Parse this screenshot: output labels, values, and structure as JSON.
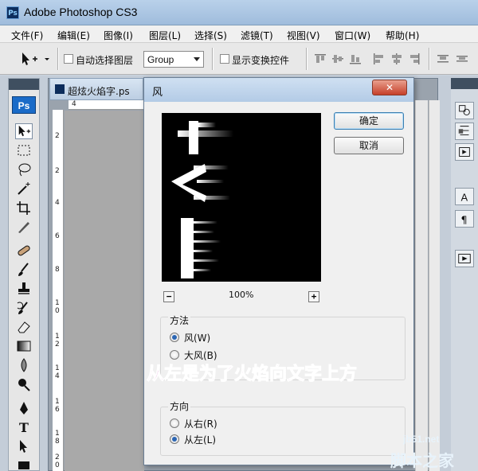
{
  "window": {
    "title": "Adobe Photoshop CS3",
    "icon": "photoshop-app-icon"
  },
  "menubar": {
    "items": [
      "文件(F)",
      "编辑(E)",
      "图像(I)",
      "图层(L)",
      "选择(S)",
      "滤镜(T)",
      "视图(V)",
      "窗口(W)",
      "帮助(H)"
    ]
  },
  "options_bar": {
    "auto_select_label": "自动选择图层",
    "auto_select_checked": false,
    "group_value": "Group",
    "show_transform_label": "显示变换控件",
    "show_transform_checked": false
  },
  "toolbox": {
    "badge": "Ps"
  },
  "document": {
    "tab_title": "超炫火焰字.ps",
    "ruler_top": [
      "4"
    ],
    "ruler_left": [
      "2",
      "2",
      "4",
      "6",
      "8",
      "1",
      "0",
      "1",
      "2",
      "1",
      "4",
      "1",
      "6",
      "1",
      "8",
      "2",
      "0",
      "2",
      "2"
    ]
  },
  "dialog": {
    "title": "风",
    "close_label": "✕",
    "ok_label": "确定",
    "cancel_label": "取消",
    "zoom_minus": "−",
    "zoom_plus": "+",
    "zoom_level": "100%",
    "method": {
      "title": "方法",
      "options": [
        "风(W)",
        "大风(B)"
      ],
      "selected": 0
    },
    "direction": {
      "title": "方向",
      "options": [
        "从右(R)",
        "从左(L)"
      ],
      "selected": 1
    }
  },
  "annotation": {
    "caption": "从左是为了火焰向文字上方"
  },
  "watermark": {
    "url": "jb51.net",
    "name": "脚本之家"
  },
  "colors": {
    "caption": "#b81d9d",
    "accent": "#2c66b3"
  }
}
